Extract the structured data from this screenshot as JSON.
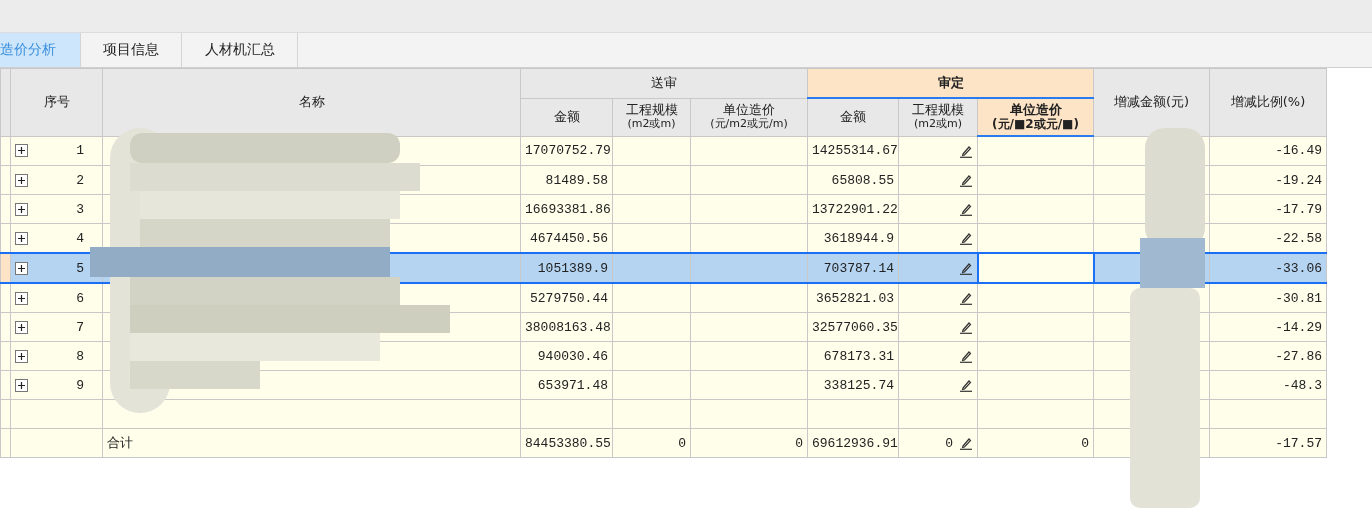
{
  "tabs": [
    {
      "label": "造价分析",
      "selected": true
    },
    {
      "label": "项目信息",
      "selected": false
    },
    {
      "label": "人材机汇总",
      "selected": false
    }
  ],
  "table": {
    "columns": {
      "seq": "序号",
      "name": "名称",
      "submitted": "送审",
      "approved": "审定",
      "diff_amount": "增减金额(元)",
      "diff_ratio": "增减比例(%)",
      "amount": "金额",
      "scale": "工程规模",
      "scale_unit": "(m2或m)",
      "unit_cost": "单位造价",
      "unit_cost_unit": "(元/m2或元/m)",
      "approved_unit_cost_unit": "(元/■2或元/■)",
      "approved_amount": "金额",
      "approved_scale": "工程规模",
      "approved_scale_unit": "(m2或m)",
      "approved_unit_cost": "单位造价"
    },
    "rows": [
      {
        "kind": "item",
        "seq": "1",
        "sd_amount": "17070752.79",
        "sh_amount": "14255314.67",
        "edit_icon": true,
        "diff_ratio": "-16.49",
        "selected": false,
        "unit_cell_focused": false
      },
      {
        "kind": "item",
        "seq": "2",
        "sd_amount": "81489.58",
        "sh_amount": "65808.55",
        "edit_icon": true,
        "diff_ratio": "-19.24",
        "selected": false,
        "unit_cell_focused": false
      },
      {
        "kind": "item",
        "seq": "3",
        "sd_amount": "16693381.86",
        "sh_amount": "13722901.22",
        "edit_icon": true,
        "diff_ratio": "-17.79",
        "selected": false,
        "unit_cell_focused": false
      },
      {
        "kind": "item",
        "seq": "4",
        "sd_amount": "4674450.56",
        "sh_amount": "3618944.9",
        "edit_icon": true,
        "diff_ratio": "-22.58",
        "selected": false,
        "unit_cell_focused": false
      },
      {
        "kind": "item",
        "seq": "5",
        "sd_amount": "1051389.9",
        "sh_amount": "703787.14",
        "edit_icon": true,
        "diff_ratio": "-33.06",
        "selected": true,
        "unit_cell_focused": true
      },
      {
        "kind": "item",
        "seq": "6",
        "sd_amount": "5279750.44",
        "sh_amount": "3652821.03",
        "edit_icon": true,
        "diff_ratio": "-30.81",
        "selected": false,
        "unit_cell_focused": false
      },
      {
        "kind": "item",
        "seq": "7",
        "sd_amount": "38008163.48",
        "sh_amount": "32577060.35",
        "edit_icon": true,
        "diff_ratio": "-14.29",
        "selected": false,
        "unit_cell_focused": false
      },
      {
        "kind": "item",
        "seq": "8",
        "sd_amount": "940030.46",
        "sh_amount": "678173.31",
        "edit_icon": true,
        "diff_ratio": "-27.86",
        "selected": false,
        "unit_cell_focused": false
      },
      {
        "kind": "item",
        "seq": "9",
        "sd_amount": "653971.48",
        "sh_amount": "338125.74",
        "edit_icon": true,
        "diff_ratio": "-48.3",
        "selected": false,
        "unit_cell_focused": false
      },
      {
        "kind": "blank",
        "selected": false,
        "unit_cell_focused": false
      },
      {
        "kind": "total",
        "name": "合计",
        "sd_amount": "84453380.55",
        "sd_scale": "0",
        "sd_unit": "0",
        "sh_amount": "69612936.91",
        "sh_scale": "0",
        "edit_icon": true,
        "sh_unit": "0",
        "diff_ratio": "-17.57",
        "selected": false,
        "unit_cell_focused": false
      }
    ]
  }
}
